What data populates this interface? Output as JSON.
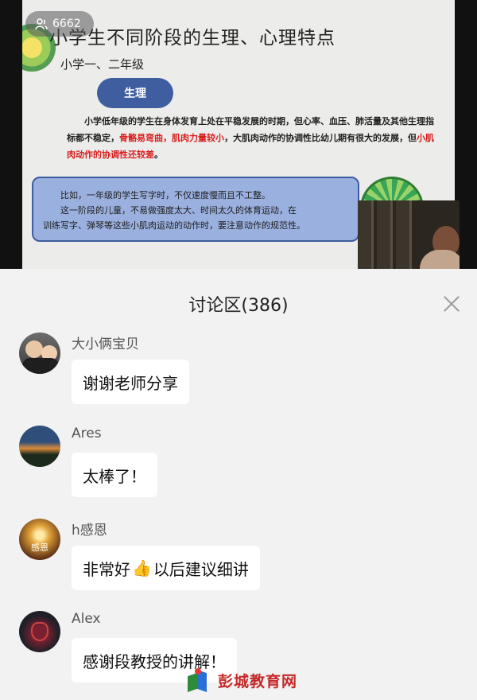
{
  "video": {
    "viewer_count": "6662",
    "slide": {
      "title": "小学生不同阶段的生理、心理特点",
      "subtitle": "小学一、二年级",
      "pill": "生理",
      "para_a": "小学低年级的学生在身体发育上处在平稳发展的时期，但心率、血压、肺活量及其他生理指标都不稳定，",
      "para_red1": "骨骼易弯曲，肌肉力量较小",
      "para_b": "，大肌肉动作的协调性比幼儿期有很大的发展，但",
      "para_red2": "小肌肉动作的协调性还较差",
      "para_c": "。",
      "box_line1": "比如，一年级的学生写字时，不仅速度慢而且不工整。",
      "box_line2": "这一阶段的儿童，不易做强度太大、时间太久的体育运动，在",
      "box_line3": "训练写字、弹琴等这些小肌肉运动的动作时，要注意动作的规范性。"
    }
  },
  "discussion": {
    "title": "讨论区(386)",
    "messages": [
      {
        "user": "大小俩宝贝",
        "text": "谢谢老师分享"
      },
      {
        "user": "Ares",
        "text": "太棒了！"
      },
      {
        "user": "h感恩",
        "text_a": "非常好",
        "emoji": "👍",
        "text_b": "以后建议细讲",
        "avatar_text": "感恩"
      },
      {
        "user": "Alex",
        "text": "感谢段教授的讲解！"
      }
    ]
  },
  "watermark": {
    "text": "彭城教育网"
  },
  "icons": {
    "viewer": "people-icon",
    "close": "close-icon",
    "thumb": "thumbs-up-icon"
  }
}
